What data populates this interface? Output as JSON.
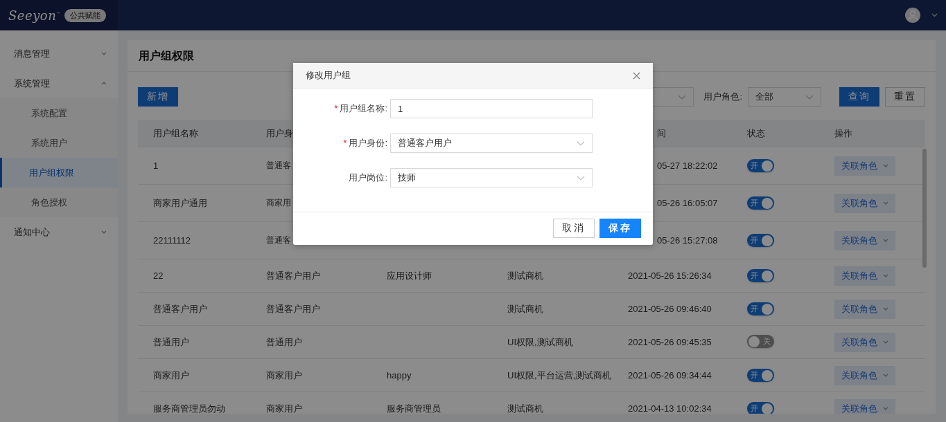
{
  "topbar": {
    "logo_text": "Seeyon",
    "logo_mark": "™",
    "badge": "公共赋能"
  },
  "sidebar": {
    "items": [
      {
        "label": "消息管理",
        "expanded": false
      },
      {
        "label": "系统管理",
        "expanded": true,
        "children": [
          {
            "label": "系统配置",
            "selected": false
          },
          {
            "label": "系统用户",
            "selected": false
          },
          {
            "label": "用户组权限",
            "selected": true
          },
          {
            "label": "角色授权",
            "selected": false
          }
        ]
      },
      {
        "label": "通知中心",
        "expanded": false
      }
    ]
  },
  "page": {
    "title": "用户组权限",
    "toolbar": {
      "add_button": "新增",
      "role_label": "用户角色:",
      "role_value": "全部",
      "query_button": "查询",
      "reset_button": "重置"
    },
    "table": {
      "columns": [
        "用户组名称",
        "用户身",
        "",
        "",
        "间",
        "状态",
        "操作"
      ],
      "rows": [
        {
          "covered": true,
          "cells": [
            "1",
            "普通客",
            "",
            "",
            "05-27 18:22:02"
          ],
          "status": {
            "on": true,
            "label": "开"
          },
          "action": "关联角色"
        },
        {
          "covered": true,
          "cells": [
            "商家用户通用",
            "商家用",
            "",
            "",
            "05-26 16:05:07"
          ],
          "status": {
            "on": true,
            "label": "开"
          },
          "action": "关联角色"
        },
        {
          "covered": true,
          "cells": [
            "22111112",
            "普通客",
            "",
            "",
            "05-26 15:27:08"
          ],
          "status": {
            "on": true,
            "label": "开"
          },
          "action": "关联角色"
        },
        {
          "covered": false,
          "cells": [
            "22",
            "普通客户用户",
            "应用设计师",
            "测试商机",
            "2021-05-26 15:26:34"
          ],
          "status": {
            "on": true,
            "label": "开"
          },
          "action": "关联角色"
        },
        {
          "covered": false,
          "cells": [
            "普通客户用户",
            "普通客户用户",
            "",
            "测试商机",
            "2021-05-26 09:46:40"
          ],
          "status": {
            "on": true,
            "label": "开"
          },
          "action": "关联角色"
        },
        {
          "covered": false,
          "cells": [
            "普通用户",
            "普通用户",
            "",
            "UI权限,测试商机",
            "2021-05-26 09:45:35"
          ],
          "status": {
            "on": false,
            "label": "关"
          },
          "action": "关联角色"
        },
        {
          "covered": false,
          "cells": [
            "商家用户",
            "商家用户",
            "happy",
            "UI权限,平台运营,测试商机",
            "2021-05-26 09:34:44"
          ],
          "status": {
            "on": true,
            "label": "开"
          },
          "action": "关联角色"
        },
        {
          "covered": false,
          "cells": [
            "服务商管理员勿动",
            "商家用户",
            "服务商管理员",
            "测试商机",
            "2021-04-13 10:02:34"
          ],
          "status": {
            "on": true,
            "label": "开"
          },
          "action": "关联角色"
        }
      ]
    }
  },
  "dialog": {
    "title": "修改用户组",
    "fields": [
      {
        "kind": "text",
        "marker": "*",
        "label": "用户组名称:",
        "value": "1"
      },
      {
        "kind": "select",
        "marker": "*",
        "label": "用户身份:",
        "value": "普通客户用户"
      },
      {
        "kind": "select",
        "label": "用户岗位:",
        "value": "技师"
      }
    ],
    "buttons": [
      {
        "label": "取消",
        "primary": false
      },
      {
        "label": "保存",
        "primary": true
      }
    ]
  }
}
